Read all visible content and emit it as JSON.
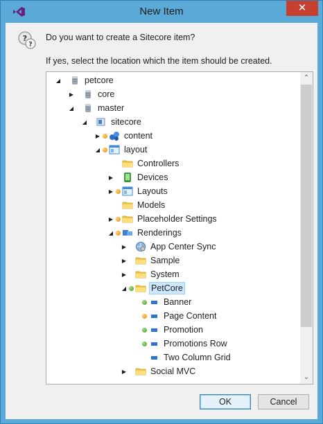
{
  "window": {
    "title": "New Item",
    "close_glyph": "✕"
  },
  "dialog": {
    "question": "Do you want to create a Sitecore item?",
    "instruction": "If yes, select the location which the item should be created."
  },
  "tree": {
    "nodes": [
      {
        "label": "petcore",
        "icon": "database-icon",
        "expander": "expanded",
        "status": ""
      },
      {
        "label": "core",
        "icon": "database-icon",
        "expander": "collapsed",
        "status": ""
      },
      {
        "label": "master",
        "icon": "database-icon",
        "expander": "expanded",
        "status": ""
      },
      {
        "label": "sitecore",
        "icon": "sitecore-root-icon",
        "expander": "expanded",
        "status": ""
      },
      {
        "label": "content",
        "icon": "content-icon",
        "expander": "collapsed",
        "status": "orange"
      },
      {
        "label": "layout",
        "icon": "layout-icon",
        "expander": "expanded",
        "status": "orange"
      },
      {
        "label": "Controllers",
        "icon": "folder-icon",
        "expander": "none",
        "status": ""
      },
      {
        "label": "Devices",
        "icon": "devices-icon",
        "expander": "collapsed",
        "status": ""
      },
      {
        "label": "Layouts",
        "icon": "layout-icon",
        "expander": "collapsed",
        "status": "orange"
      },
      {
        "label": "Models",
        "icon": "folder-icon",
        "expander": "none",
        "status": ""
      },
      {
        "label": "Placeholder Settings",
        "icon": "folder-icon",
        "expander": "collapsed",
        "status": "orange"
      },
      {
        "label": "Renderings",
        "icon": "renderings-icon",
        "expander": "expanded",
        "status": "orange"
      },
      {
        "label": "App Center Sync",
        "icon": "globe-icon",
        "expander": "collapsed",
        "status": ""
      },
      {
        "label": "Sample",
        "icon": "folder-icon",
        "expander": "collapsed",
        "status": ""
      },
      {
        "label": "System",
        "icon": "folder-icon",
        "expander": "collapsed",
        "status": ""
      },
      {
        "label": "PetCore",
        "icon": "folder-icon",
        "expander": "expanded",
        "status": "green",
        "selected": true
      },
      {
        "label": "Banner",
        "icon": "rendering-item-icon",
        "expander": "none",
        "status": "green"
      },
      {
        "label": "Page Content",
        "icon": "rendering-item-icon",
        "expander": "none",
        "status": "orange"
      },
      {
        "label": "Promotion",
        "icon": "rendering-item-icon",
        "expander": "none",
        "status": "green"
      },
      {
        "label": "Promotions Row",
        "icon": "rendering-item-icon",
        "expander": "none",
        "status": "green"
      },
      {
        "label": "Two Column Grid",
        "icon": "rendering-item-icon",
        "expander": "none",
        "status": ""
      },
      {
        "label": "Social MVC",
        "icon": "folder-icon",
        "expander": "collapsed",
        "status": ""
      }
    ]
  },
  "buttons": {
    "ok": "OK",
    "cancel": "Cancel"
  },
  "scrollbar": {
    "up": "⌃",
    "down": "⌄"
  },
  "colors": {
    "titlebar": "#5aa9d6",
    "close": "#c7402f",
    "selection": "#cce8ff",
    "status_orange": "#e48a00",
    "status_green": "#3d9a2a"
  }
}
